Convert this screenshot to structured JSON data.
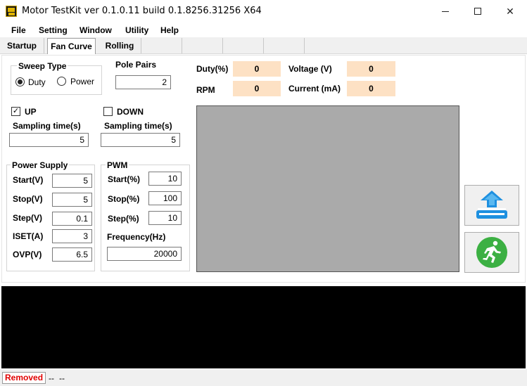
{
  "window": {
    "title": "Motor TestKit ver 0.1.0.11 build 0.1.8256.31256 X64",
    "minimize_label": "",
    "maximize_label": "",
    "close_label": "✕"
  },
  "menu": {
    "items": [
      {
        "label": "File"
      },
      {
        "label": "Setting"
      },
      {
        "label": "Window"
      },
      {
        "label": "Utility"
      },
      {
        "label": "Help"
      }
    ]
  },
  "tabs": [
    {
      "label": "Startup",
      "active": false
    },
    {
      "label": "Fan Curve",
      "active": true
    },
    {
      "label": "Rolling",
      "active": false
    }
  ],
  "sweep_type": {
    "title": "Sweep Type",
    "options": [
      {
        "label": "Duty",
        "checked": true
      },
      {
        "label": "Power",
        "checked": false
      }
    ]
  },
  "pole_pairs": {
    "label": "Pole Pairs",
    "value": "2"
  },
  "readouts": {
    "duty": {
      "label": "Duty(%)",
      "value": "0"
    },
    "voltage": {
      "label": "Voltage (V)",
      "value": "0"
    },
    "rpm": {
      "label": "RPM",
      "value": "0"
    },
    "current": {
      "label": "Current (mA)",
      "value": "0"
    },
    "bg_color": "#fde1c4"
  },
  "up": {
    "label": "UP",
    "checked": true,
    "sampling_label": "Sampling time(s)",
    "sampling_value": "5"
  },
  "down": {
    "label": "DOWN",
    "checked": false,
    "sampling_label": "Sampling time(s)",
    "sampling_value": "5"
  },
  "power_supply": {
    "title": "Power Supply",
    "rows": [
      {
        "label": "Start(V)",
        "value": "5"
      },
      {
        "label": "Stop(V)",
        "value": "5"
      },
      {
        "label": "Step(V)",
        "value": "0.1"
      },
      {
        "label": "ISET(A)",
        "value": "3"
      },
      {
        "label": "OVP(V)",
        "value": "6.5"
      }
    ]
  },
  "pwm": {
    "title": "PWM",
    "rows": [
      {
        "label": "Start(%)",
        "value": "10"
      },
      {
        "label": "Stop(%)",
        "value": "100"
      },
      {
        "label": "Step(%)",
        "value": "10"
      }
    ],
    "frequency_label": "Frequency(Hz)",
    "frequency_value": "20000"
  },
  "buttons": {
    "upload_icon": "upload-device-icon",
    "run_icon": "running-man-icon"
  },
  "status": {
    "device_state": "Removed",
    "field1": "--",
    "field2": "--",
    "state_color": "#e00000"
  }
}
